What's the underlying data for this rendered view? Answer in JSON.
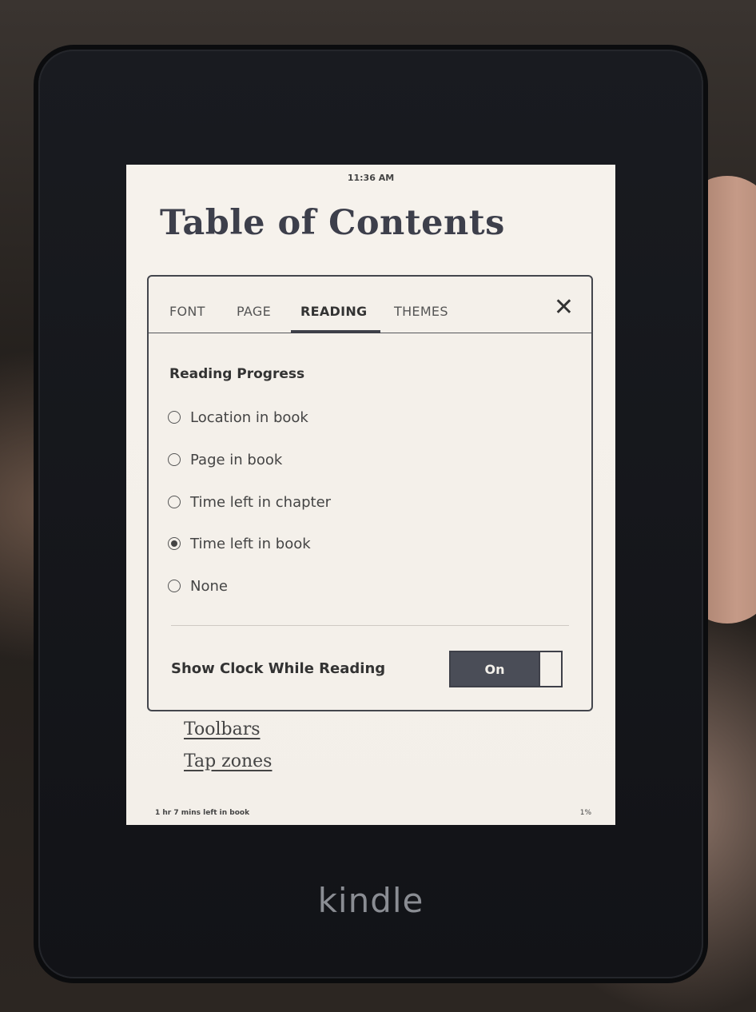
{
  "status_bar": {
    "time": "11:36 AM"
  },
  "book": {
    "title": "Table of Contents",
    "links": [
      "Toolbars",
      "Tap zones"
    ],
    "footer_progress": "1 hr 7 mins left in book",
    "footer_percent": "1%"
  },
  "settings": {
    "tabs": [
      {
        "label": "FONT",
        "active": false
      },
      {
        "label": "PAGE",
        "active": false
      },
      {
        "label": "READING",
        "active": true
      },
      {
        "label": "THEMES",
        "active": false
      }
    ],
    "close_icon": "close-icon",
    "section_title": "Reading Progress",
    "options": [
      {
        "label": "Location in book",
        "selected": false
      },
      {
        "label": "Page in book",
        "selected": false
      },
      {
        "label": "Time left in chapter",
        "selected": false
      },
      {
        "label": "Time left in book",
        "selected": true
      },
      {
        "label": "None",
        "selected": false
      }
    ],
    "clock_setting": {
      "label": "Show Clock While Reading",
      "toggle_label": "On",
      "enabled": true
    }
  },
  "device": {
    "brand": "kindle"
  },
  "colors": {
    "screen_bg": "#f4f0ea",
    "ink": "#3d3f4b",
    "toggle_fill": "#4a4d57"
  }
}
